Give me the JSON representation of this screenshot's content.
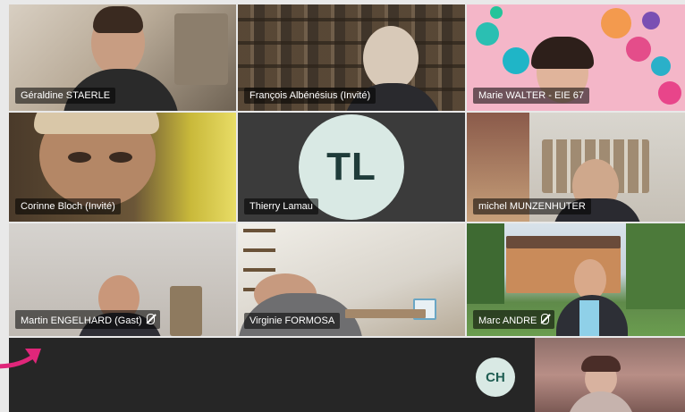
{
  "meeting": {
    "participants": [
      {
        "name": "Géraldine STAERLE",
        "muted": false
      },
      {
        "name": "François Albénésius (Invité)",
        "muted": false
      },
      {
        "name": "Marie WALTER - EIE 67",
        "muted": false
      },
      {
        "name": "Corinne Bloch (Invité)",
        "muted": false
      },
      {
        "name": "Thierry Lamau",
        "initials": "TL",
        "muted": false
      },
      {
        "name": "michel MUNZENHUTER",
        "muted": false
      },
      {
        "name": "Martin ENGELHARD (Gast)",
        "muted": true
      },
      {
        "name": "Virginie FORMOSA",
        "muted": false
      },
      {
        "name": "Marc ANDRE",
        "muted": true
      }
    ],
    "strip": {
      "initials": "CH"
    }
  },
  "colors": {
    "avatar_bg": "#d9e9e4",
    "avatar_text": "#1f3c3a",
    "tile_dark": "#3a3a3a",
    "bottom_bar": "#262626",
    "arrow": "#e0267a"
  },
  "icons": [
    "mic-muted-icon",
    "arrow-icon"
  ]
}
